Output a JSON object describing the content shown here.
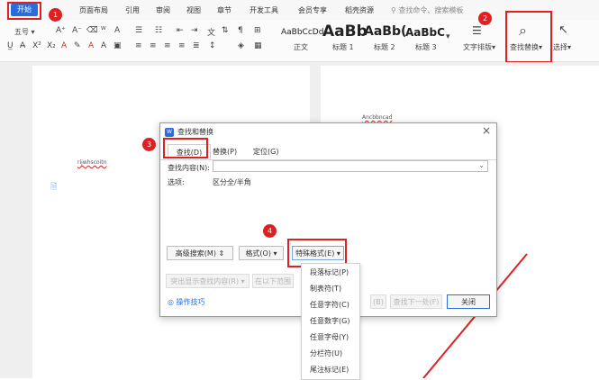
{
  "menubar": {
    "start": "开始",
    "items": [
      "页面布局",
      "引用",
      "审阅",
      "视图",
      "章节",
      "开发工具",
      "会员专享",
      "稻壳资源"
    ],
    "search_placeholder": "查找命令、搜索模板"
  },
  "ribbon": {
    "font_size": "五号",
    "styles": [
      {
        "preview": "AaBbCcDd",
        "name": "正文"
      },
      {
        "preview": "AaBb",
        "name": "标题 1"
      },
      {
        "preview": "AaBb(",
        "name": "标题 2"
      },
      {
        "preview": "AaBbC",
        "name": "标题 3"
      }
    ],
    "text_layout": "文字排版",
    "find_replace": "查找替换",
    "select": "选择"
  },
  "document": {
    "left_text": "rijwhscoitn",
    "right_text": "Ancbbncad"
  },
  "badges": [
    "1",
    "2",
    "3",
    "4"
  ],
  "dialog": {
    "title": "查找和替换",
    "tabs": [
      "查找(D)",
      "替换(P)",
      "定位(G)"
    ],
    "find_label": "查找内容(N):",
    "find_value": "",
    "options_label": "选项:",
    "options_value": "区分全/半角",
    "advanced_search": "高级搜索(M)",
    "format": "格式(O)",
    "special_format": "特殊格式(E)",
    "highlight_all": "突出显示查找内容(R)",
    "find_in": "在以下范围",
    "find_prev": "(B)",
    "find_next": "查找下一处(F)",
    "close": "关闭",
    "tips": "操作技巧"
  },
  "special_format_menu": [
    "段落标记(P)",
    "制表符(T)",
    "任意字符(C)",
    "任意数字(G)",
    "任意字母(Y)",
    "分栏符(U)",
    "尾注标记(E)"
  ],
  "colors": {
    "accent": "#2b6cd8",
    "highlight": "#e02020"
  }
}
